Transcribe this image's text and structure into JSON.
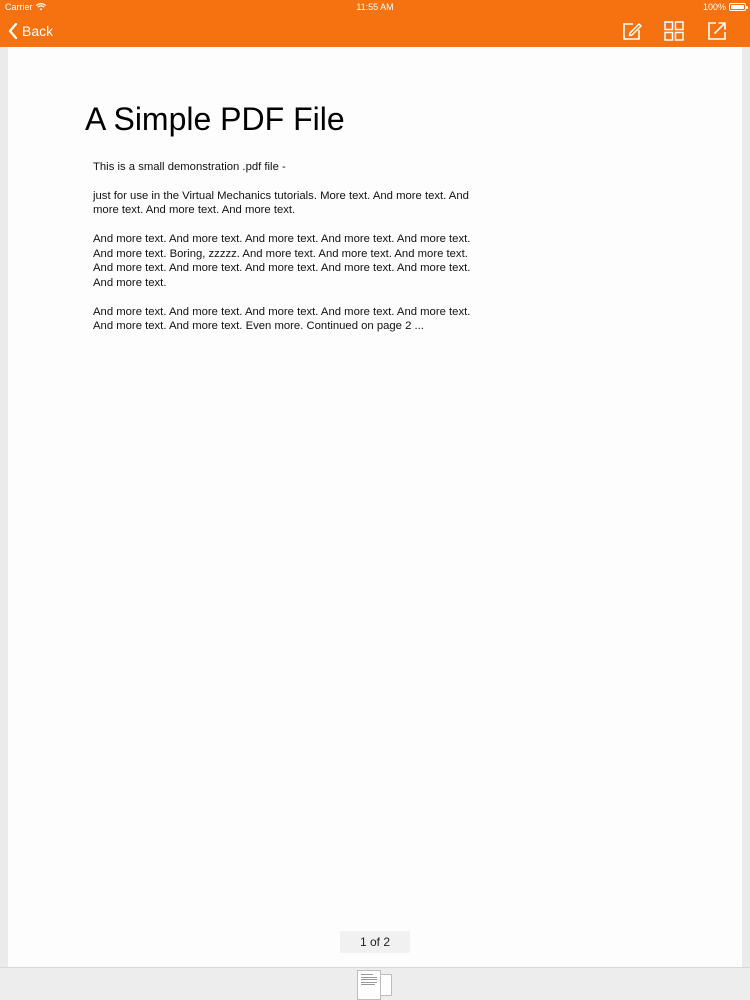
{
  "status_bar": {
    "carrier": "Carrier",
    "time": "11:55 AM",
    "battery": "100%"
  },
  "nav_bar": {
    "back_label": "Back",
    "accent_color": "#f6710f",
    "icons": [
      "pencil-square-icon",
      "grid-icon",
      "share-arrow-icon"
    ]
  },
  "document": {
    "title": "A Simple PDF File",
    "paragraphs": [
      "This is a small demonstration .pdf file -",
      "just for use in the Virtual Mechanics tutorials. More text. And more text. And more text. And more text. And more text.",
      "And more text. And more text. And more text. And more text. And more text. And more text. Boring, zzzzz. And more text. And more text. And more text. And more text. And more text. And more text. And more text. And more text. And more text.",
      "And more text. And more text. And more text. And more text. And more text. And more text. And more text. Even more. Continued on page 2 ..."
    ]
  },
  "pagination": {
    "label": "1 of 2",
    "current_page": 1,
    "total_pages": 2
  }
}
